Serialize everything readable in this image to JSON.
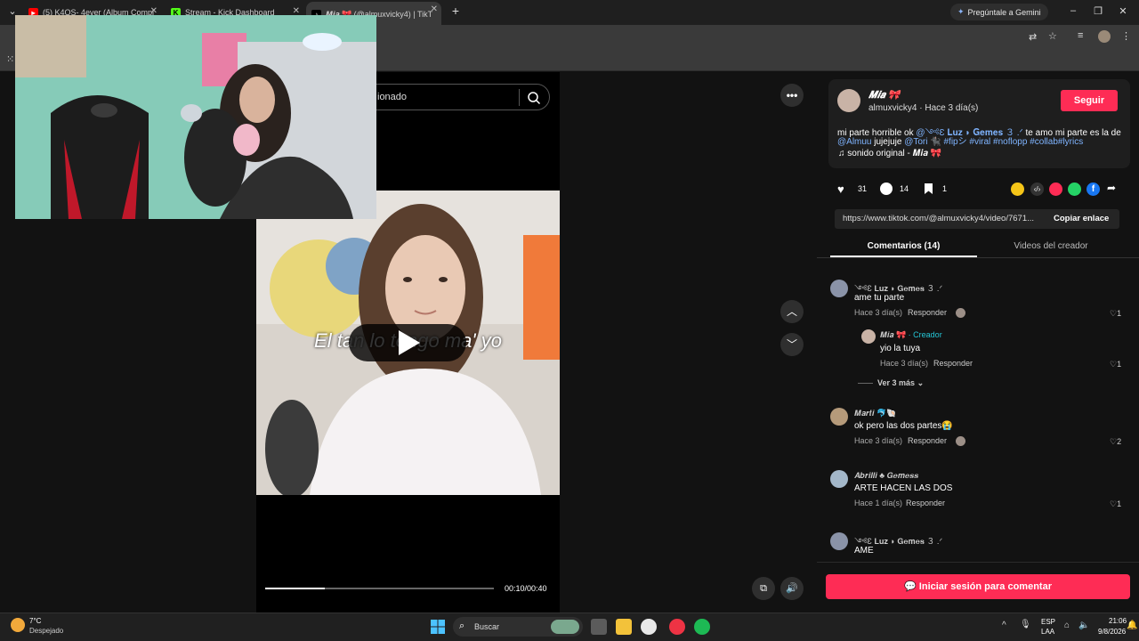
{
  "browser": {
    "tabs": [
      {
        "label": "(5) K4OS- 4ever (Album Compl",
        "favicon": "youtube-icon",
        "color": "#ff0000"
      },
      {
        "label": "Stream - Kick Dashboard",
        "favicon": "kick-icon",
        "color": "#53fc18"
      },
      {
        "label": "𝑴𝒊𝒂 🎀 (@almuxvicky4) | TikT",
        "favicon": "tiktok-icon",
        "color": "#ffffff"
      }
    ],
    "new_tab": "+",
    "gemini_label": "Pregúntale a Gemini",
    "window_controls": [
      "–",
      "❐",
      "✕"
    ]
  },
  "search": {
    "value": "ionado"
  },
  "video": {
    "caption": "El tan lo tengo ma' yo",
    "time": "00:10/00:40",
    "progress_fraction": 0.26
  },
  "post": {
    "author_name": "𝑴𝒊𝒂 🎀",
    "handle": "almuxvicky4",
    "time_ago": "Hace 3 día(s)",
    "follow_label": "Seguir",
    "desc_line1_a": "mi parte horrible ok ",
    "desc_line1_mention": "@༺Ɛ 𝐋𝐮𝐳 ◗ 𝐆𝐞𝐦𝐞𝐬 ３ .ᐟ",
    "desc_line1_b": " te amo mi parte es la de",
    "desc_line2_mention1": "@Almuu",
    "desc_line2_mid": " jujejuje ",
    "desc_line2_mention2": "@Tori 🐈‍⬛",
    "desc_line2_tags": " #fipシ #viral #noflopp #collab#lyrics",
    "sound": "sonido original - 𝑴𝒊𝒂 🎀",
    "likes": "31",
    "comments": "14",
    "saves": "1",
    "url": "https://www.tiktok.com/@almuxvicky4/video/7671...",
    "copy_label": "Copiar enlace"
  },
  "panel_tabs": {
    "comments": "Comentarios (14)",
    "creator_videos": "Videos del creador"
  },
  "comments": [
    {
      "user": "༺Ɛ 𝐋𝐮𝐳 ◗ 𝐆𝐞𝐦𝐞𝐬 ３ .ᐟ",
      "text": "ame tu parte",
      "time": "Hace 3 día(s)",
      "reply": "Responder",
      "likes": "1"
    },
    {
      "user": "𝑴𝒊𝒂 🎀",
      "creator": "· Creador",
      "text": "yio la tuya",
      "time": "Hace 3 día(s)",
      "reply": "Responder",
      "likes": "1"
    },
    {
      "user": "𝑴𝒂𝒓𝒕𝒊 🐬🐚",
      "text": "ok pero las dos partes😭",
      "time": "Hace 3 día(s)",
      "reply": "Responder",
      "likes": "2"
    },
    {
      "user": "𝑨𝒃𝒓𝒊𝒍𝒍𝒊 ♣ 𝑮𝒆𝒎𝒆𝒔𝒔",
      "text": "ARTE HACEN LAS DOS",
      "time": "Hace 1 día(s)",
      "reply": "Responder",
      "likes": "1"
    },
    {
      "user": "༺Ɛ 𝐋𝐮𝐳 ◗ 𝐆𝐞𝐦𝐞𝐬 ３ .ᐟ",
      "text": "AME"
    }
  ],
  "see_more": "Ver 3 más",
  "login_comment": "Iniciar sesión para comentar",
  "taskbar": {
    "weather_temp": "7°C",
    "weather_desc": "Despejado",
    "search_label": "Buscar",
    "lang_1": "ESP",
    "lang_2": "LAA",
    "clock_time": "21:06",
    "clock_date": "9/8/2026"
  },
  "colors": {
    "accent": "#fe2c55",
    "link": "#7fb4ff"
  }
}
